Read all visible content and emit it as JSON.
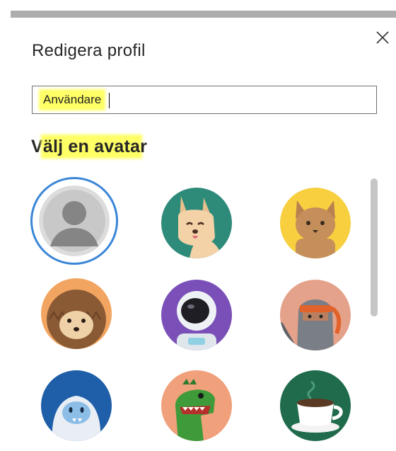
{
  "dialog": {
    "title": "Redigera profil",
    "close_icon": "close-icon"
  },
  "name_field": {
    "value": "Användare"
  },
  "avatar_section": {
    "title_prefix": "V",
    "title_highlighted": "älj en avata",
    "title_suffix": "r",
    "avatars": [
      {
        "icon": "default-person-icon",
        "selected": true
      },
      {
        "icon": "dog-icon",
        "selected": false
      },
      {
        "icon": "cat-icon",
        "selected": false
      },
      {
        "icon": "hedgehog-icon",
        "selected": false
      },
      {
        "icon": "astronaut-icon",
        "selected": false
      },
      {
        "icon": "ninja-icon",
        "selected": false
      },
      {
        "icon": "yeti-icon",
        "selected": false
      },
      {
        "icon": "dinosaur-icon",
        "selected": false
      },
      {
        "icon": "coffee-cup-icon",
        "selected": false
      }
    ]
  },
  "colors": {
    "selection_ring": "#3a86d6",
    "highlight": "#ffff66"
  }
}
